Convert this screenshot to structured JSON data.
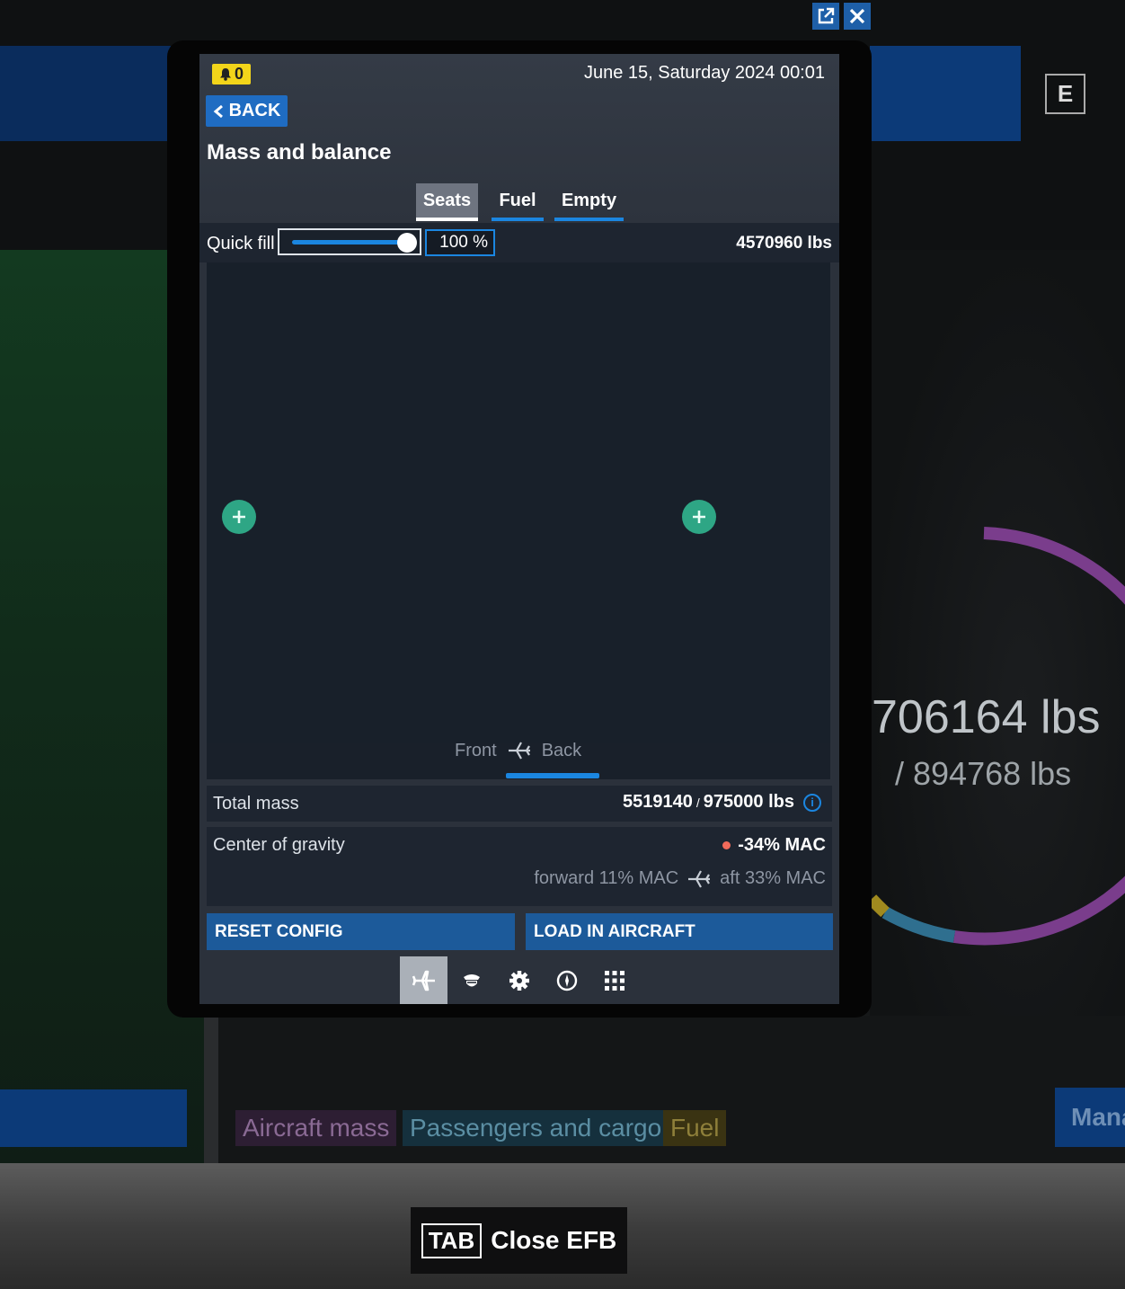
{
  "window_controls": {
    "popout_icon": "popout-icon",
    "close_icon": "close-icon"
  },
  "background": {
    "key_hint": "E",
    "mass_current": "706164 lbs",
    "mass_max": "/ 894768 lbs",
    "legend": [
      "Aircraft mass",
      "Passengers and cargo",
      "Fuel"
    ],
    "right_button_label": "Mana",
    "colors": {
      "aircraft_mass": "#7a3d8c",
      "passengers_cargo": "#2f6f8f",
      "fuel": "#a08a1f"
    }
  },
  "efb": {
    "notifications": {
      "icon": "bell-icon",
      "count": "0"
    },
    "datetime": "June 15, Saturday 2024 00:01",
    "back_label": "BACK",
    "title": "Mass and balance",
    "tabs": [
      {
        "label": "Seats",
        "active": true
      },
      {
        "label": "Fuel",
        "active": false
      },
      {
        "label": "Empty",
        "active": false
      }
    ],
    "quick_fill": {
      "label": "Quick fill",
      "percent": "100 %",
      "level": 1.0,
      "weight": "4570960 lbs"
    },
    "seat_map": {
      "front_label": "Front",
      "back_label": "Back",
      "add_buttons": [
        "plus-icon",
        "plus-icon"
      ]
    },
    "total_mass": {
      "label": "Total mass",
      "current": "5519140",
      "separator": "/",
      "max": "975000 lbs"
    },
    "center_of_gravity": {
      "label": "Center of gravity",
      "value": "-34% MAC",
      "forward": "forward 11% MAC",
      "aft": "aft 33% MAC"
    },
    "actions": {
      "reset": "RESET CONFIG",
      "load": "LOAD IN AIRCRAFT"
    },
    "nav": [
      "airplane-icon",
      "pilot-icon",
      "gear-icon",
      "compass-icon",
      "apps-grid-icon"
    ],
    "accent_color": "#1b86e0",
    "warning_color": "#f26b5b"
  },
  "tab_hint": {
    "key": "TAB",
    "label": "Close EFB"
  }
}
